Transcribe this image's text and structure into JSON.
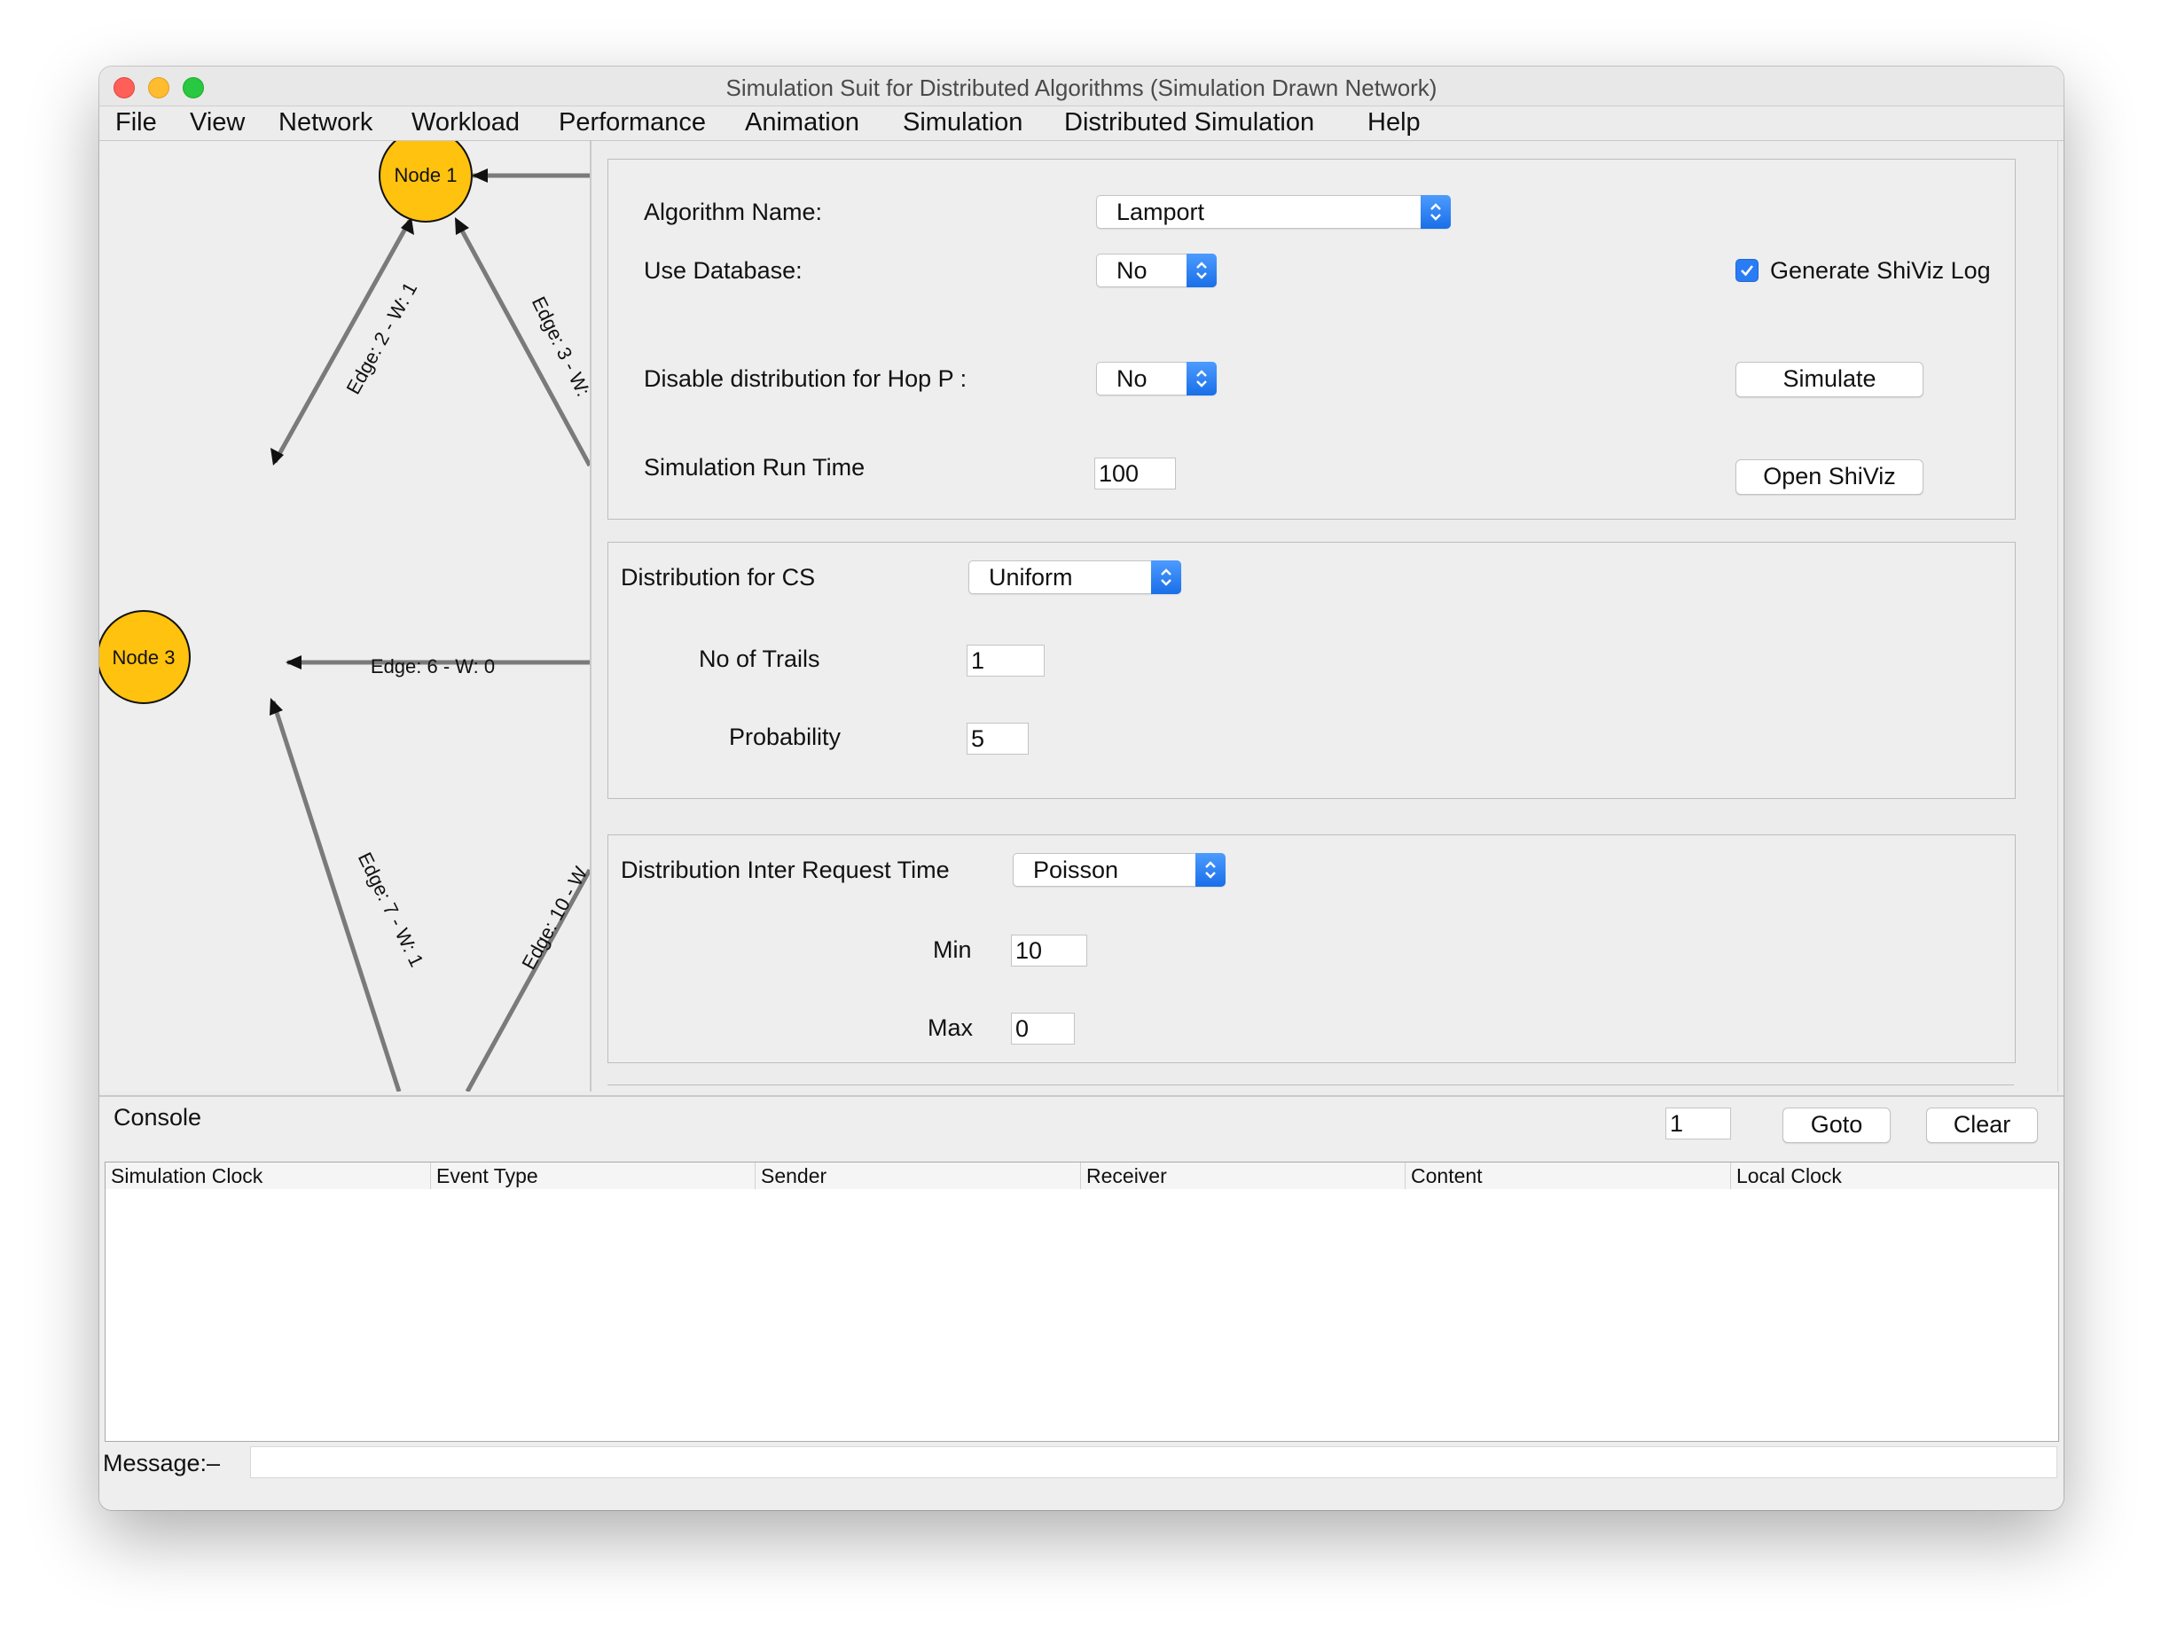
{
  "window": {
    "title": "Simulation Suit for Distributed Algorithms (Simulation Drawn Network)"
  },
  "menubar": {
    "items": [
      "File",
      "View",
      "Network",
      "Workload",
      "Performance",
      "Animation",
      "Simulation",
      "Distributed Simulation",
      "Help"
    ]
  },
  "network": {
    "nodes": [
      "Node 1",
      "Node 3"
    ],
    "edges": [
      "Edge: 2 - W: 1",
      "Edge: 3 - W:",
      "Edge: 6 - W: 0",
      "Edge: 7 - W: 1",
      "Edge: 10 - W"
    ],
    "node_color": "#ffc20e"
  },
  "settings": {
    "algorithm_label": "Algorithm Name:",
    "algorithm_value": "Lamport",
    "use_db_label": "Use Database:",
    "use_db_value": "No",
    "generate_shiviz_label": "Generate ShiViz Log",
    "generate_shiviz_checked": true,
    "disable_hop_label": "Disable distribution for Hop P :",
    "disable_hop_value": "No",
    "simulate_button": "Simulate",
    "run_time_label": "Simulation Run Time",
    "run_time_value": "100",
    "open_shiviz_button": "Open ShiViz"
  },
  "cs": {
    "dist_label": "Distribution for CS",
    "dist_value": "Uniform",
    "trails_label": "No of Trails",
    "trails_value": "1",
    "prob_label": "Probability",
    "prob_value": "5"
  },
  "inter_request": {
    "dist_label": "Distribution Inter Request Time",
    "dist_value": "Poisson",
    "min_label": "Min",
    "min_value": "10",
    "max_label": "Max",
    "max_value": "0"
  },
  "console": {
    "title": "Console",
    "goto_value": "1",
    "goto_button": "Goto",
    "clear_button": "Clear",
    "columns": [
      "Simulation Clock",
      "Event Type",
      "Sender",
      "Receiver",
      "Content",
      "Local Clock"
    ],
    "message_label": "Message:–"
  },
  "colors": {
    "accent": "#2a7cf5",
    "window_bg": "#ececec"
  }
}
